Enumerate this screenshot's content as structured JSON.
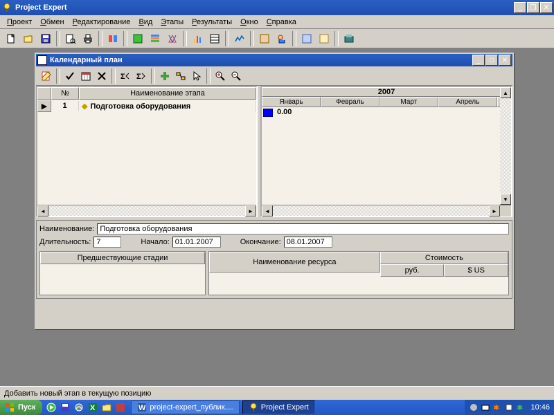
{
  "app": {
    "title": "Project Expert"
  },
  "menu": [
    "Проект",
    "Обмен",
    "Редактирование",
    "Вид",
    "Этапы",
    "Результаты",
    "Окно",
    "Справка"
  ],
  "childwin": {
    "title": "Календарный план",
    "columns": {
      "num": "№",
      "name": "Наименование этапа"
    },
    "row": {
      "num": "1",
      "name": "Подготовка оборудования"
    },
    "gantt": {
      "year": "2007",
      "months": [
        "Январь",
        "Февраль",
        "Март",
        "Апрель"
      ],
      "value": "0.00"
    }
  },
  "details": {
    "name_label": "Наименование:",
    "name_value": "Подготовка оборудования",
    "duration_label": "Длительность:",
    "duration_value": "7",
    "start_label": "Начало:",
    "start_value": "01.01.2007",
    "end_label": "Окончание:",
    "end_value": "08.01.2007",
    "predecessors_header": "Предшествующие стадии",
    "resource_header": "Наименование ресурса",
    "cost_header": "Стоимость",
    "cost_rub": "руб.",
    "cost_usd": "$ US"
  },
  "status": "Добавить новый этап в текущую позицию",
  "taskbar": {
    "start": "Пуск",
    "tasks": [
      "project-expert_публик....",
      "Project Expert"
    ],
    "clock": "10:46"
  }
}
